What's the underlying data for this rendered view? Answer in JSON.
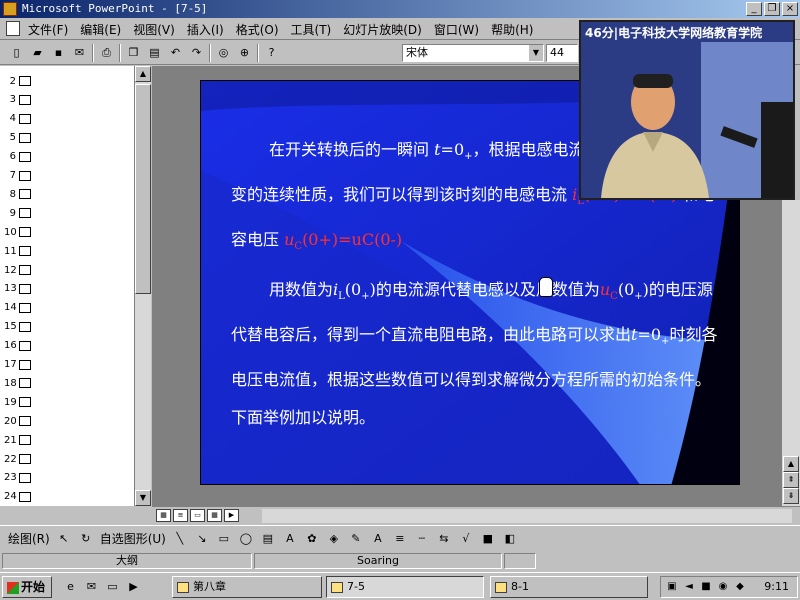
{
  "window": {
    "title": "Microsoft PowerPoint - [7-5]",
    "controls": [
      "_",
      "❐",
      "×"
    ]
  },
  "menu": {
    "items": [
      "文件(F)",
      "编辑(E)",
      "视图(V)",
      "插入(I)",
      "格式(O)",
      "工具(T)",
      "幻灯片放映(D)",
      "窗口(W)",
      "帮助(H)"
    ]
  },
  "toolbar": {
    "font": "宋体",
    "size": "44"
  },
  "outline": {
    "slide_numbers": [
      "2",
      "3",
      "4",
      "5",
      "6",
      "7",
      "8",
      "9",
      "10",
      "11",
      "12",
      "13",
      "14",
      "15",
      "16",
      "17",
      "18",
      "19",
      "20",
      "21",
      "22",
      "23",
      "24"
    ]
  },
  "slide": {
    "p1_a": "在开关转换后的一瞬间 ",
    "p1_t": "t",
    "p1_eq": "=0",
    "p1_sub": "+",
    "p1_b": "，根据电感电流和电容电压不能跃变的连续性质，我们可以得到该时刻的电感电流 ",
    "p1_il": "i",
    "p1_il_sub": "L",
    "p1_il_val": "(0+)=iL(0-)",
    "p1_c": " 和电容电压 ",
    "p1_uc": "u",
    "p1_uc_sub": "C",
    "p1_uc_val": "(0+)=uC(0-)",
    "p2_a": "用数值为",
    "p2_i": "i",
    "p2_i_sub": "L",
    "p2_i_val": "(0",
    "p2_i_plus": "+",
    "p2_i_close": ")",
    "p2_b": "的电流源代替电感以及用数值为",
    "p2_u": "u",
    "p2_u_sub": "C",
    "p2_u_val": "(0",
    "p2_u_plus": "+",
    "p2_u_close": ")",
    "p2_c": "的电压源代替电容后，得到一个直流电阻电路，由此电路可以求出",
    "p2_t": "t",
    "p2_eq": "=0",
    "p2_plus": "+",
    "p2_d": "时刻各电压电流值，根据这些数值可以得到求解微分方程所需的初始条件。下面举例加以说明。"
  },
  "video": {
    "caption": "46分|电子科技大学网络教育学院"
  },
  "drawbar": {
    "draw_label": "绘图(R)",
    "autoshape_label": "自选图形(U)"
  },
  "status": {
    "outline": "大纲",
    "design": "Soaring"
  },
  "taskbar": {
    "start": "开始",
    "tasks": [
      "第八章",
      "7-5",
      "8-1"
    ],
    "clock": "9:11"
  }
}
